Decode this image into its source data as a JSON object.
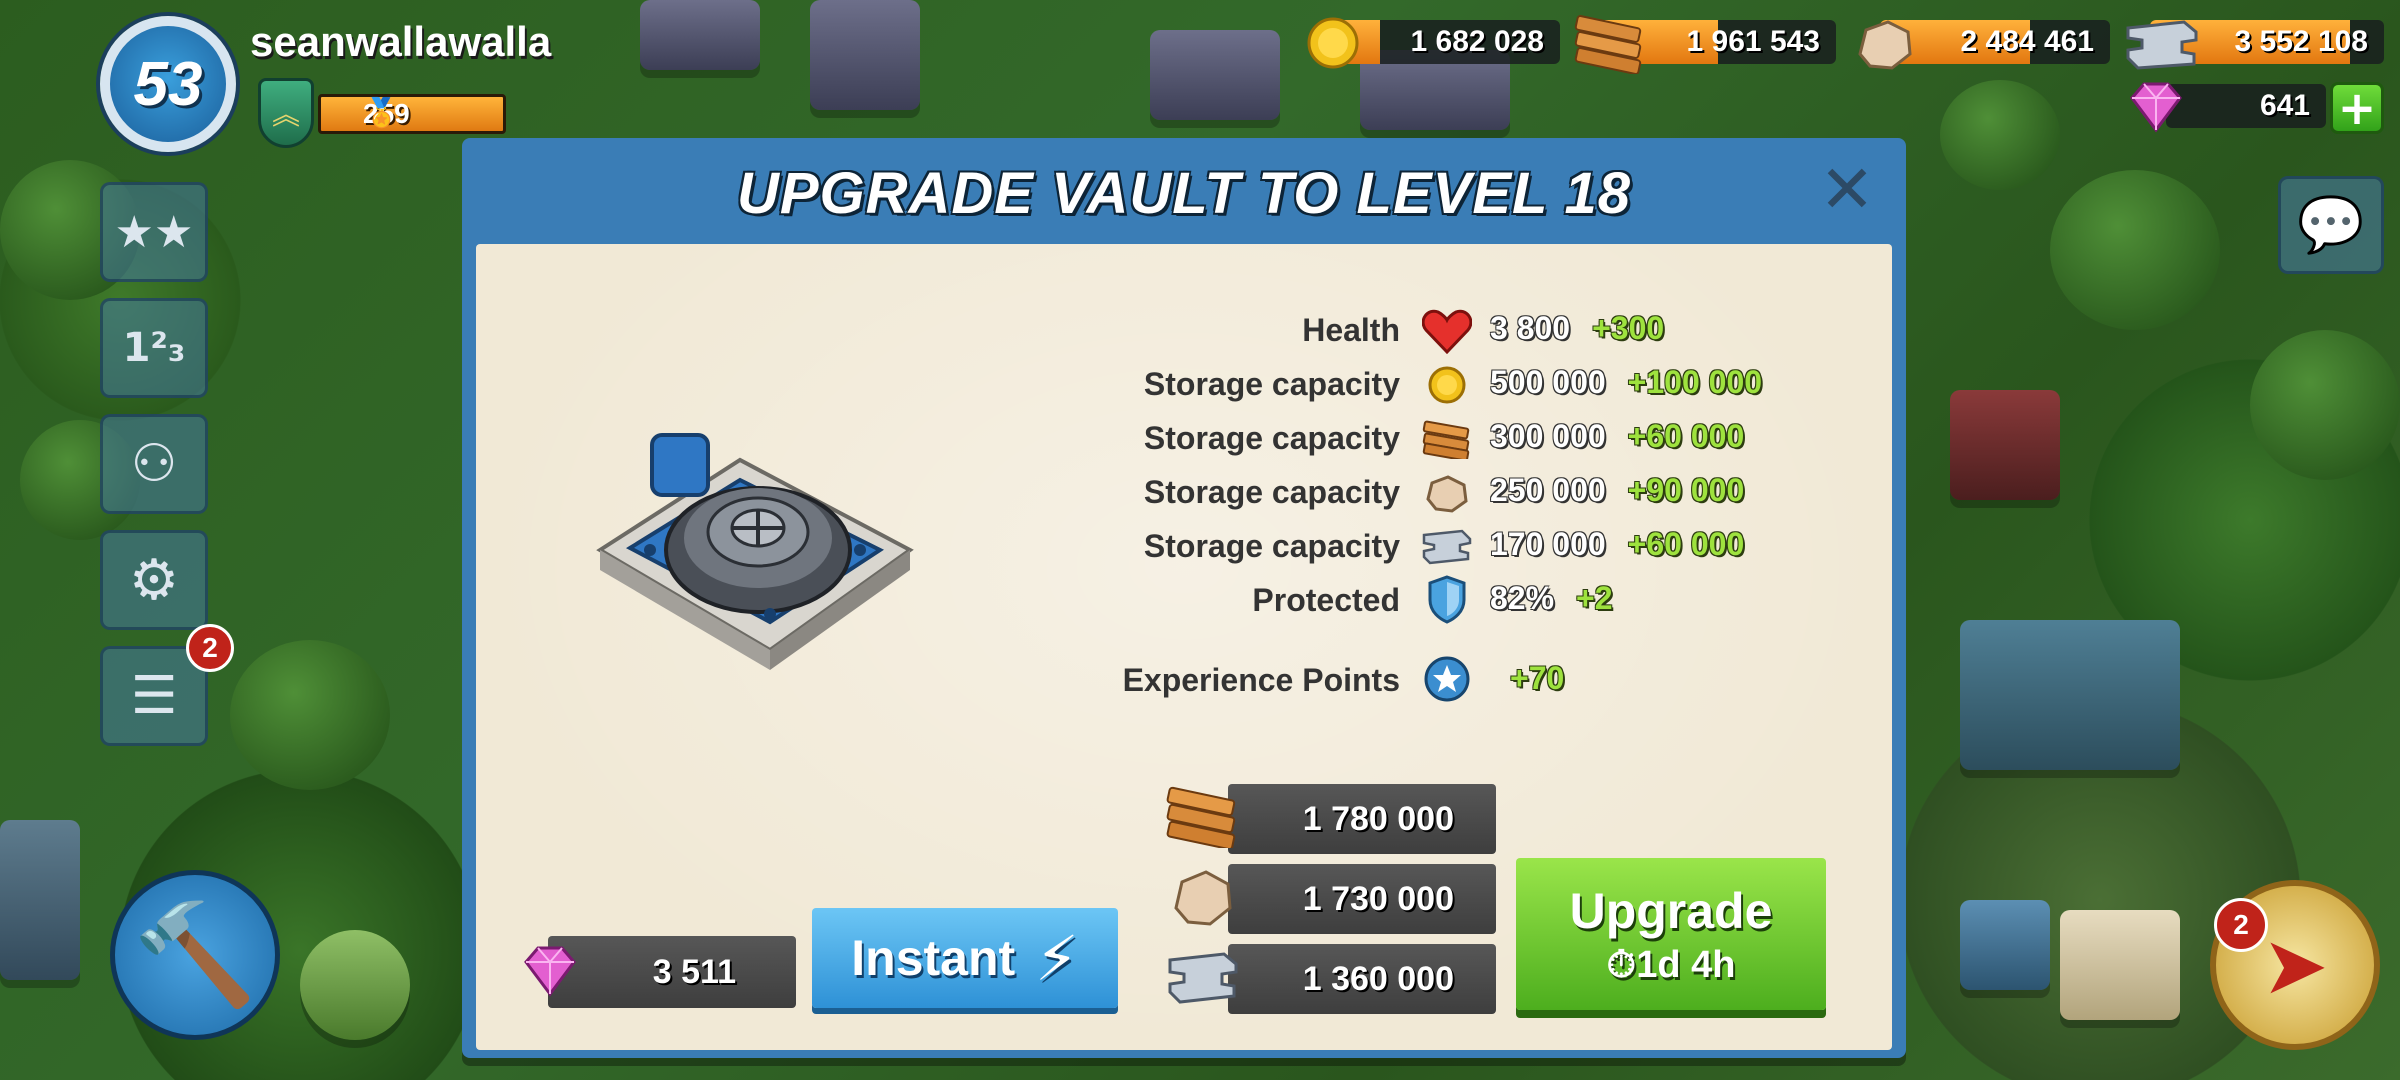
{
  "player": {
    "level": "53",
    "name": "seanwallawalla",
    "medals": "259"
  },
  "resources": {
    "gold": "1 682 028",
    "wood": "1 961 543",
    "stone": "2 484 461",
    "iron": "3 552 108",
    "diamonds": "641"
  },
  "side_menu": {
    "newspaper_badge": "2"
  },
  "map_badge": "2",
  "dialog": {
    "title": "UPGRADE VAULT TO LEVEL 18",
    "stats": [
      {
        "label": "Health",
        "icon": "heart-icon",
        "value": "3 800",
        "increase": "+300"
      },
      {
        "label": "Storage capacity",
        "icon": "gold-coin-icon",
        "value": "500 000",
        "increase": "+100 000"
      },
      {
        "label": "Storage capacity",
        "icon": "wood-icon",
        "value": "300 000",
        "increase": "+60 000"
      },
      {
        "label": "Storage capacity",
        "icon": "stone-icon",
        "value": "250 000",
        "increase": "+90 000"
      },
      {
        "label": "Storage capacity",
        "icon": "iron-icon",
        "value": "170 000",
        "increase": "+60 000"
      },
      {
        "label": "Protected",
        "icon": "shield-icon",
        "value": "82%",
        "increase": "+2"
      }
    ],
    "xp": {
      "label": "Experience Points",
      "icon": "xp-star-icon",
      "increase": "+70"
    },
    "costs": {
      "wood": "1 780 000",
      "stone": "1 730 000",
      "iron": "1 360 000"
    },
    "gem_cost": "3 511",
    "instant_label": "Instant",
    "upgrade_label": "Upgrade",
    "upgrade_time": "1d 4h"
  },
  "colors": {
    "dialog_frame": "#3a7db6",
    "panel": "#f1e9d6",
    "upgrade_green": "#6cc92f",
    "instant_blue": "#45a8e6",
    "increase_green": "#9ee23e",
    "resource_orange": "#f29a25"
  }
}
